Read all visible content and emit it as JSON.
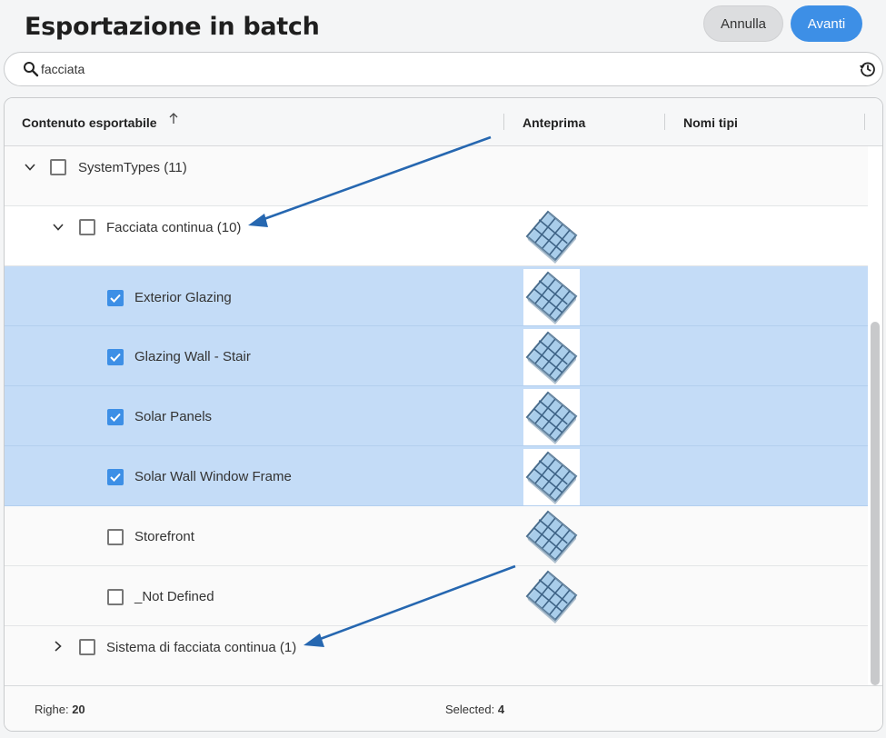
{
  "header": {
    "title": "Esportazione in batch",
    "cancel_label": "Annulla",
    "next_label": "Avanti"
  },
  "search": {
    "value": "facciata",
    "placeholder": ""
  },
  "table": {
    "columns": [
      {
        "label": "Contenuto esportabile",
        "sorted": "ascending"
      },
      {
        "label": "Anteprima"
      },
      {
        "label": "Nomi tipi"
      }
    ],
    "rows": [
      {
        "label": "SystemTypes (11)",
        "level": 0,
        "expanded": true,
        "checked": false,
        "preview": false
      },
      {
        "label": "Facciata continua (10)",
        "level": 1,
        "expanded": true,
        "checked": false,
        "preview": true
      },
      {
        "label": "Exterior Glazing",
        "level": 2,
        "checked": true,
        "preview": true
      },
      {
        "label": "Glazing Wall - Stair",
        "level": 2,
        "checked": true,
        "preview": true
      },
      {
        "label": "Solar Panels",
        "level": 2,
        "checked": true,
        "preview": true
      },
      {
        "label": "Solar Wall Window Frame",
        "level": 2,
        "checked": true,
        "preview": true
      },
      {
        "label": "Storefront",
        "level": 2,
        "checked": false,
        "preview": true
      },
      {
        "label": "_Not Defined",
        "level": 2,
        "checked": false,
        "preview": true
      },
      {
        "label": "Sistema di facciata continua (1)",
        "level": 1,
        "expanded": false,
        "checked": false,
        "preview": false
      }
    ]
  },
  "footer": {
    "rows_label": "Righe:",
    "rows_value": "20",
    "selected_label": "Selected:",
    "selected_value": "4"
  },
  "colors": {
    "accent": "#3d8fe6",
    "selected_row": "#c4dcf7",
    "annotation_arrow": "#2667b0"
  },
  "icons": [
    "search-icon",
    "history-icon",
    "sort-up-icon",
    "chevron-down-icon",
    "chevron-right-icon",
    "checkbox-icon",
    "curtain-wall-preview-icon"
  ]
}
